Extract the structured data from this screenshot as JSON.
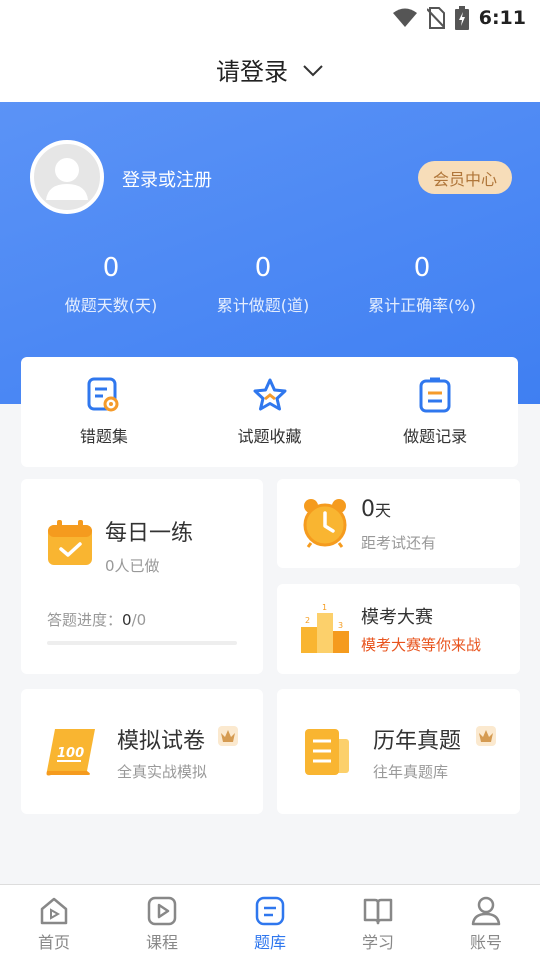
{
  "status_bar": {
    "time": "6:11"
  },
  "header": {
    "title": "请登录"
  },
  "profile": {
    "login_text": "登录或注册",
    "vip_label": "会员中心"
  },
  "stats": [
    {
      "value": "0",
      "label": "做题天数(天)"
    },
    {
      "value": "0",
      "label": "累计做题(道)"
    },
    {
      "value": "0",
      "label": "累计正确率(%)"
    }
  ],
  "quick_actions": [
    {
      "label": "错题集",
      "icon": "wrong-questions-icon"
    },
    {
      "label": "试题收藏",
      "icon": "star-icon"
    },
    {
      "label": "做题记录",
      "icon": "record-icon"
    }
  ],
  "daily_practice": {
    "title": "每日一练",
    "subtitle": "0人已做",
    "progress_label": "答题进度：",
    "progress_value": "0",
    "progress_total": "/0",
    "progress_fraction": 0
  },
  "exam_countdown": {
    "days": "0",
    "unit": "天",
    "subtitle": "距考试还有"
  },
  "mock_contest": {
    "title": "模考大赛",
    "subtitle": "模考大赛等你来战"
  },
  "mock_paper": {
    "title": "模拟试卷",
    "subtitle": "全真实战模拟"
  },
  "past_papers": {
    "title": "历年真题",
    "subtitle": "往年真题库"
  },
  "tabbar": [
    {
      "label": "首页",
      "icon": "home-icon"
    },
    {
      "label": "课程",
      "icon": "course-icon"
    },
    {
      "label": "题库",
      "icon": "question-bank-icon",
      "active": true
    },
    {
      "label": "学习",
      "icon": "book-icon"
    },
    {
      "label": "账号",
      "icon": "account-icon"
    }
  ],
  "colors": {
    "primary": "#3f7ff2",
    "accent_orange": "#f7a823",
    "vip_bg": "#f7ddb9",
    "contest_red": "#e8541e"
  }
}
